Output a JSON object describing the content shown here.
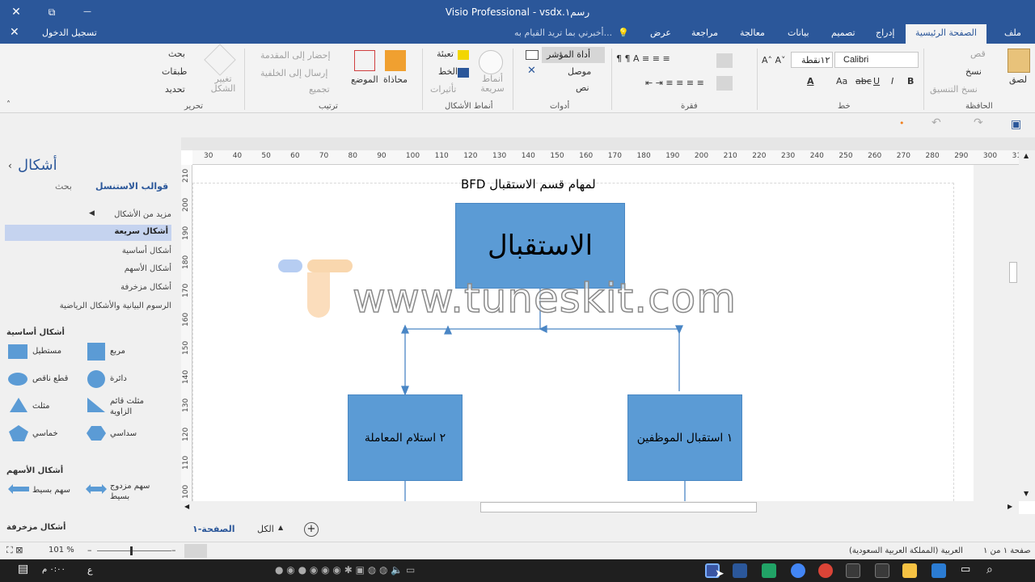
{
  "window": {
    "title": "Visio Professional - vsdx.رسم١",
    "close_glyph": "✕",
    "restore_glyph": "⧉",
    "minimize_glyph": "—"
  },
  "tabs": {
    "signin": "تسجيل الدخول",
    "tellme": "أخبرني بما تريد القيام به...",
    "items": [
      "ملف",
      "الصفحة الرئيسية",
      "إدراج",
      "تصميم",
      "بيانات",
      "معالجة",
      "مراجعة",
      "عرض"
    ]
  },
  "ribbon": {
    "clipboard": {
      "paste": "لصق",
      "cut": "قص",
      "copy": "نسخ",
      "format_painter": "نسخ التنسيق",
      "label": "الحافظة"
    },
    "font": {
      "name": "Calibri",
      "size": "١٢نقطة",
      "label": "خط"
    },
    "paragraph": {
      "label": "فقرة"
    },
    "tools": {
      "pointer": "أداة المؤشر",
      "connector": "موصل",
      "text": "نص",
      "label": "أدوات"
    },
    "shape_styles": {
      "fill": "تعبئة",
      "line": "الخط",
      "effects": "تأثيرات",
      "quick": "أنماط سريعة",
      "label": "أنماط الأشكال"
    },
    "arrange": {
      "align": "محاذاة",
      "position": "الموضع",
      "bring_front": "إحضار إلى المقدمة",
      "send_back": "إرسال إلى الخلفية",
      "group": "تجميع",
      "label": "ترتيب"
    },
    "editing": {
      "change_shape": "تغيير الشكل",
      "find": "بحث",
      "layers": "طبقات",
      "select": "تحديد",
      "label": "تحرير"
    }
  },
  "shapes_pane": {
    "title": "أشكال",
    "stencils": "قوالب الاستنسل",
    "search": "بحث",
    "more": "مزيد من الأشكال",
    "quick": "أشكال سريعة",
    "list": [
      "أشكال أساسية",
      "أشكال الأسهم",
      "أشكال مزخرفة",
      "الرسوم البيانية والأشكال الرياضية"
    ],
    "basic_header": "أشكال أساسية",
    "basic": [
      "مربع",
      "مستطيل",
      "دائرة",
      "قطع ناقص",
      "مثلث قائم الزاوية",
      "مثلث",
      "سداسي",
      "خماسي"
    ],
    "arrows_header": "أشكال الأسهم",
    "arrows": [
      "سهم مزدوج بسيط",
      "سهم بسيط"
    ],
    "decor_header": "أشكال مزخرفة"
  },
  "ruler": {
    "h": [
      "30",
      "40",
      "50",
      "60",
      "70",
      "80",
      "90",
      "100",
      "110",
      "120",
      "130",
      "140",
      "150",
      "160",
      "170",
      "180",
      "190",
      "200",
      "210",
      "220",
      "230",
      "240",
      "250",
      "260",
      "270",
      "280",
      "290",
      "300",
      "31"
    ],
    "v": [
      "210",
      "200",
      "190",
      "180",
      "170",
      "160",
      "150",
      "140",
      "130",
      "120",
      "110",
      "100"
    ]
  },
  "diagram": {
    "title": "BFD  لمهام قسم الاستقبال",
    "main": "الاستقبال",
    "box1": "١ استقبال الموظفين",
    "box2": "٢ استلام المعاملة"
  },
  "watermark": "www.tuneskit.com",
  "pages": {
    "page": "الصفحة-١",
    "all": "الكل"
  },
  "status": {
    "page_info": "صفحة ١ من ١",
    "language": "العربية (المملكة العربية السعودية)",
    "zoom": "101 %"
  },
  "taskbar": {
    "time": "٠:٠٠ م",
    "lang": "ع"
  },
  "colors": {
    "brand": "#2b579a",
    "shape_fill": "#5b9bd5",
    "connector": "#4a86c5"
  }
}
